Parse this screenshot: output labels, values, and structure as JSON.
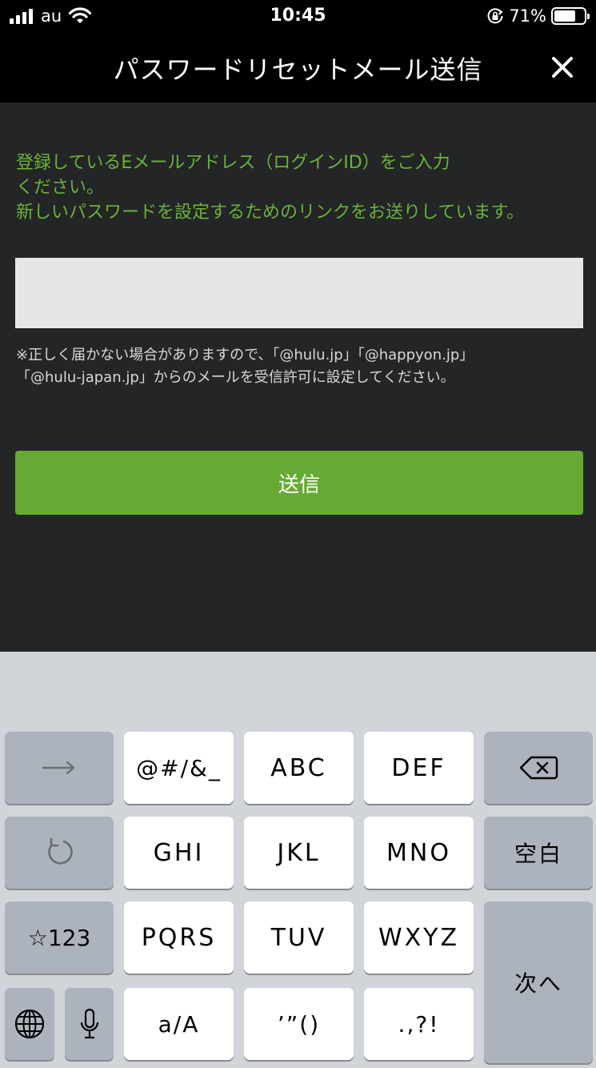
{
  "status_bar": {
    "carrier": "au",
    "time": "10:45",
    "battery_percent": "71%",
    "battery_level": 0.71
  },
  "header": {
    "title": "パスワードリセットメール送信",
    "close_icon": "close-icon"
  },
  "content": {
    "instruction_lines": [
      "登録しているEメールアドレス（ログインID）をご入力",
      "ください。",
      "新しいパスワードを設定するためのリンクをお送りしています。"
    ],
    "email_input": {
      "value": "",
      "placeholder": ""
    },
    "note_lines": [
      "※正しく届かない場合がありますので、「@hulu.jp」「@happyon.jp」",
      "「@hulu-japan.jp」からのメールを受信許可に設定してください。"
    ],
    "submit_label": "送信"
  },
  "colors": {
    "accent_green": "#66aa34",
    "instruction_green": "#6cb23a",
    "background": "#232526",
    "header": "#000000"
  },
  "keyboard": {
    "arrow_icon": "arrow-right-icon",
    "symbols": "@#/&_",
    "abc": "ABC",
    "def": "DEF",
    "backspace_icon": "delete-backspace-icon",
    "undo_icon": "undo-icon",
    "ghi": "GHI",
    "jkl": "JKL",
    "mno": "MNO",
    "space": "空白",
    "numbers": "☆123",
    "pqrs": "PQRS",
    "tuv": "TUV",
    "wxyz": "WXYZ",
    "next": "次へ",
    "globe_icon": "globe-icon",
    "mic_icon": "microphone-icon",
    "case": "a/A",
    "quotes": "’”()",
    "punct": ".,?!"
  }
}
